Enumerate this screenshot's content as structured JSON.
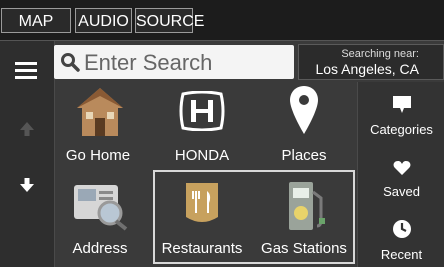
{
  "topbar": {
    "map_label": "MAP",
    "audio_label": "AUDIO",
    "source_label": "SOURCE"
  },
  "search": {
    "placeholder": "Enter Search"
  },
  "near": {
    "label": "Searching near:",
    "city": "Los Angeles, CA"
  },
  "grid": {
    "items": [
      {
        "label": "Go Home"
      },
      {
        "label": "HONDA"
      },
      {
        "label": "Places"
      },
      {
        "label": "Address"
      },
      {
        "label": "Restaurants"
      },
      {
        "label": "Gas Stations"
      }
    ]
  },
  "right_menu": {
    "items": [
      {
        "label": "Categories"
      },
      {
        "label": "Saved"
      },
      {
        "label": "Recent"
      }
    ]
  },
  "colors": {
    "background": "#3a3a3a",
    "topbar": "#1c1c1c",
    "highlight_border": "#d8d8d8"
  }
}
